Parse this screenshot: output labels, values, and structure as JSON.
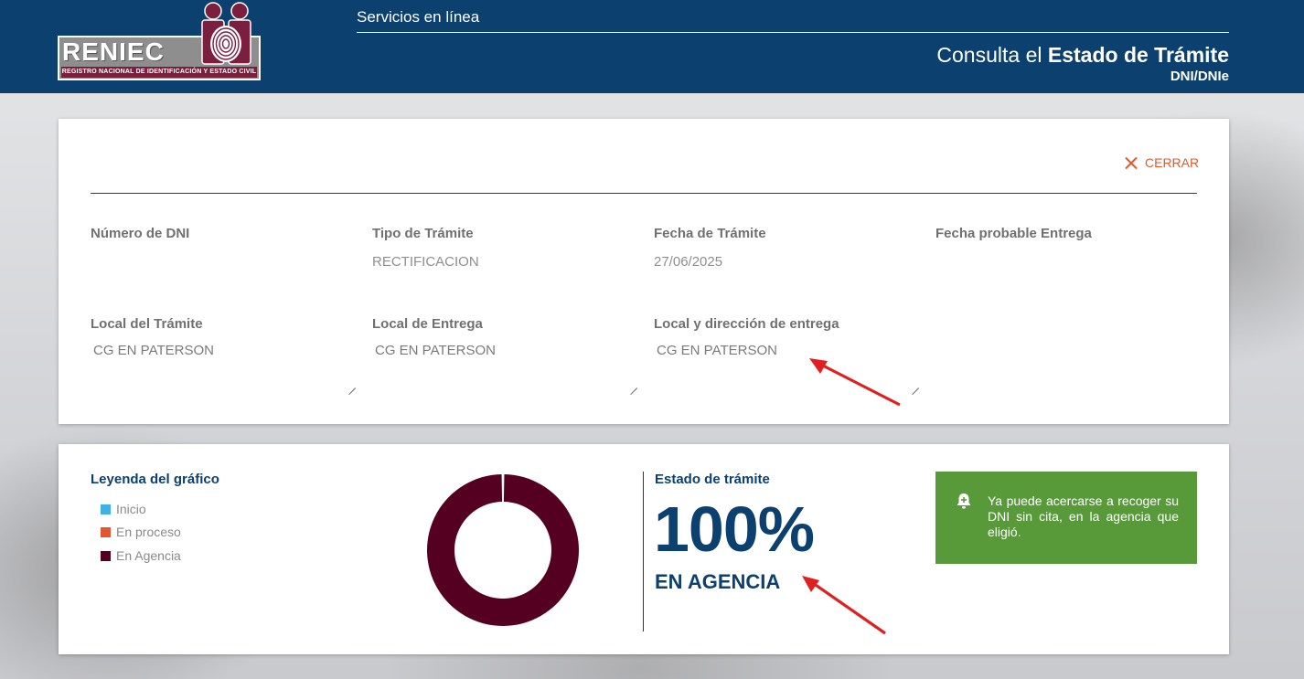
{
  "header": {
    "logo_text": "RENIEC",
    "logo_subtitle": "REGISTRO NACIONAL DE IDENTIFICACIÓN Y ESTADO CIVIL",
    "services_label": "Servicios en línea",
    "title_prefix": "Consulta el ",
    "title_bold": "Estado de Trámite",
    "subtitle": "DNI/DNIe"
  },
  "details": {
    "close_label": "CERRAR",
    "dni_label": "Número de DNI",
    "dni_value": "",
    "tipo_label": "Tipo de Trámite",
    "tipo_value": "RECTIFICACION",
    "fecha_label": "Fecha de Trámite",
    "fecha_value": "27/06/2025",
    "fecha_entrega_label": "Fecha probable Entrega",
    "fecha_entrega_value": "",
    "local_tramite_label": "Local del Trámite",
    "local_tramite_value": "CG EN PATERSON",
    "local_entrega_label": "Local de Entrega",
    "local_entrega_value": "CG EN PATERSON",
    "direccion_label": "Local y dirección de entrega",
    "direccion_value": "CG EN PATERSON"
  },
  "legend": {
    "title": "Leyenda del gráfico",
    "items": [
      {
        "label": "Inicio",
        "color": "#3fb1e5"
      },
      {
        "label": "En proceso",
        "color": "#e4572e"
      },
      {
        "label": "En Agencia",
        "color": "#560021"
      }
    ]
  },
  "chart_data": {
    "type": "pie",
    "categories": [
      "Inicio",
      "En proceso",
      "En Agencia"
    ],
    "values": [
      0,
      0,
      100
    ],
    "colors": [
      "#3fb1e5",
      "#e4572e",
      "#560021"
    ],
    "donut": true
  },
  "status": {
    "label": "Estado de trámite",
    "percent": "100%",
    "text": "EN AGENCIA"
  },
  "notice": {
    "text": "Ya puede acercarse a recoger su DNI sin cita, en la agencia que eligió.",
    "icon": "bell-plus-icon"
  },
  "annotations": {
    "arrow_color": "#e02020"
  }
}
